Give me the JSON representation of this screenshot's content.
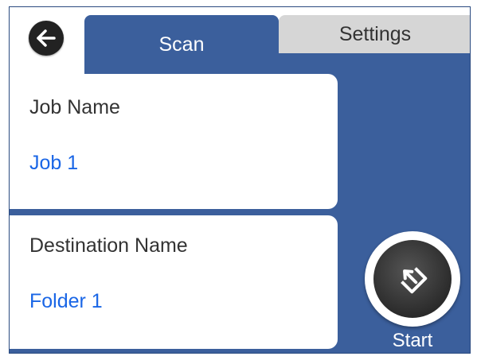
{
  "header": {
    "back_icon": "arrow-left-icon",
    "tabs": [
      {
        "label": "Scan",
        "active": true
      },
      {
        "label": "Settings",
        "active": false
      }
    ]
  },
  "fields": {
    "job": {
      "label": "Job Name",
      "value": "Job 1"
    },
    "destination": {
      "label": "Destination Name",
      "value": "Folder 1"
    }
  },
  "start": {
    "label": "Start",
    "icon": "scan-start-icon"
  },
  "colors": {
    "panel_blue": "#3b5f9c",
    "value_blue": "#1a66e6",
    "inactive_tab": "#d6d6d6",
    "button_dark": "#2b2b2b"
  }
}
